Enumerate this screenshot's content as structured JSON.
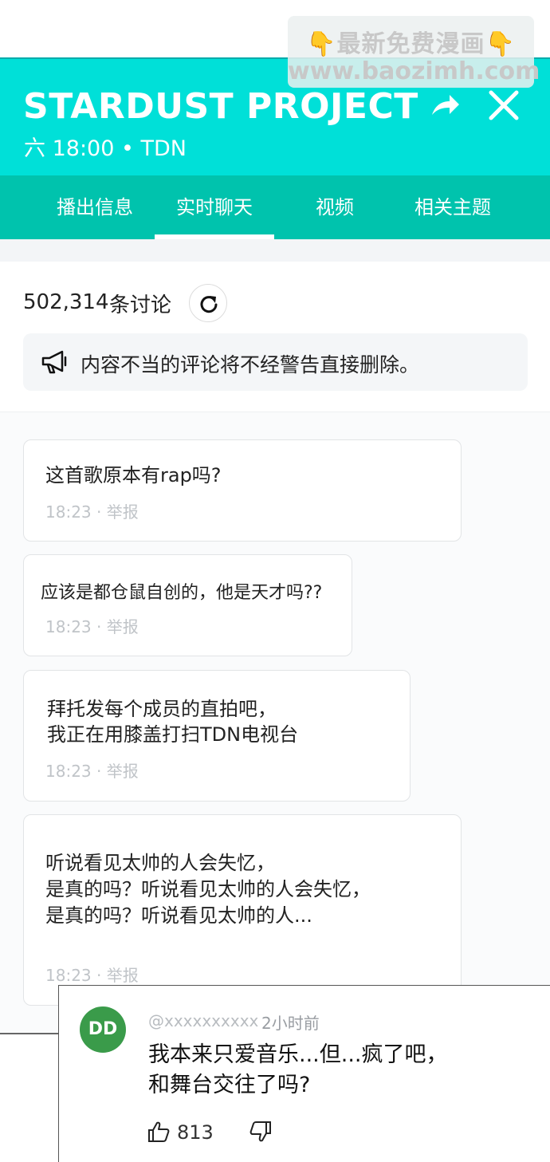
{
  "watermark": {
    "line1": "最新免费漫画",
    "line2": "www.baozimh.com",
    "emoji": "👇"
  },
  "header": {
    "title": "STARDUST PROJECT",
    "subtitle": "六 18:00 • TDN",
    "share_icon": "share-arrow",
    "close_icon": "close-x"
  },
  "tabs": [
    {
      "label": "播出信息",
      "active": false
    },
    {
      "label": "实时聊天",
      "active": true
    },
    {
      "label": "视频",
      "active": false
    },
    {
      "label": "相关主题",
      "active": false
    }
  ],
  "discussion": {
    "count": "502,314",
    "count_label": "条讨论",
    "refresh_icon": "refresh"
  },
  "notice": {
    "icon": "megaphone",
    "text": "内容不当的评论将不经警告直接删除。"
  },
  "messages": [
    {
      "lines": [
        "这首歌原本有rap吗?"
      ],
      "meta": "18:23 · 举报"
    },
    {
      "lines": [
        "应该是都仓鼠自创的，他是天才吗??"
      ],
      "meta": "18:23 · 举报"
    },
    {
      "lines": [
        "拜托发每个成员的直拍吧，",
        "我正在用膝盖打扫TDN电视台"
      ],
      "meta": "18:23 · 举报"
    },
    {
      "lines": [
        "听说看见太帅的人会失忆，",
        "是真的吗？听说看见太帅的人会失忆，",
        "是真的吗？听说看见太帅的人..."
      ],
      "meta": "18:23 · 举报"
    }
  ],
  "comment": {
    "avatar": "DD",
    "user": "@xxxxxxxxxx",
    "time": "2小时前",
    "lines": [
      "我本来只爱音乐...但...疯了吧，",
      "和舞台交往了吗?"
    ],
    "likes": "813",
    "colors": {
      "avatar_bg": "#3a9b4a"
    }
  },
  "colors": {
    "header_bg": "#00e0d8",
    "tabs_bg": "#00c3ad"
  }
}
